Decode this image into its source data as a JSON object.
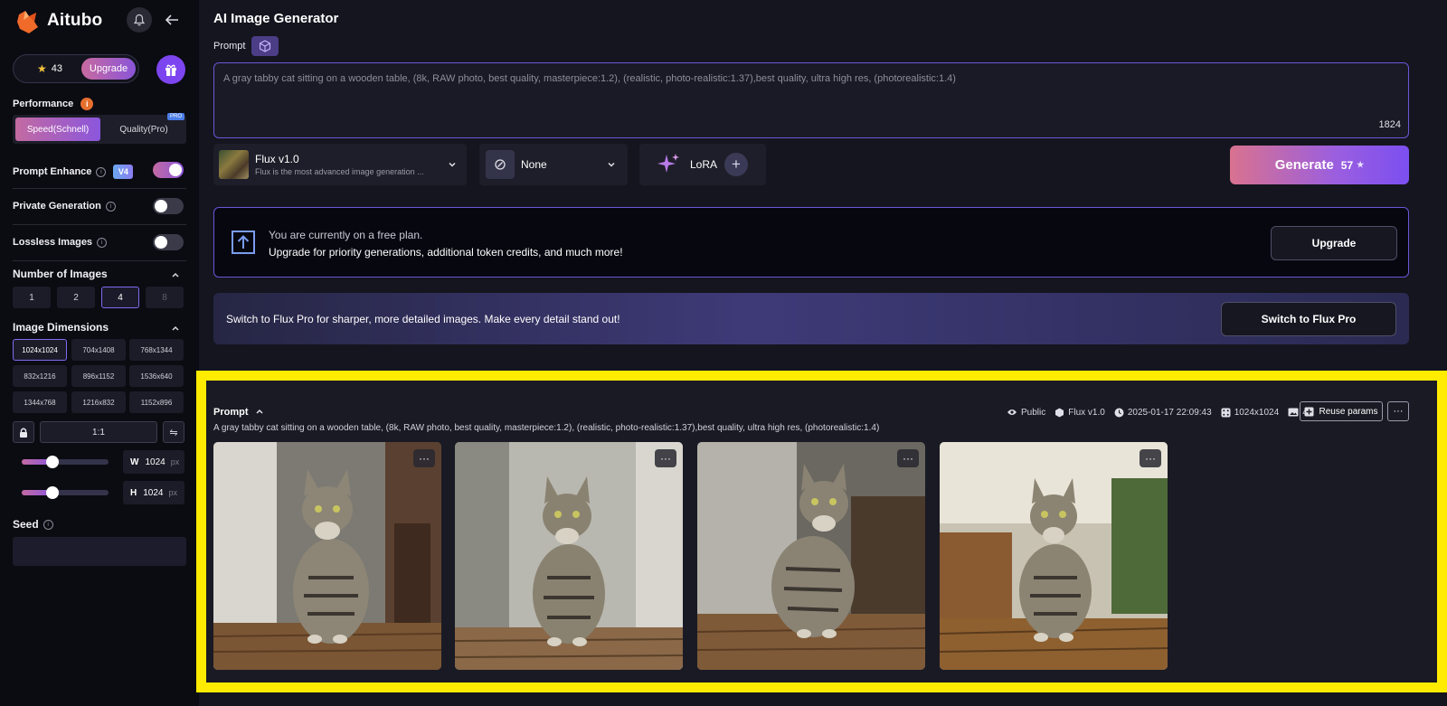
{
  "brand": {
    "name": "Aitubo"
  },
  "account": {
    "credits": "43",
    "upgrade_label": "Upgrade"
  },
  "sidebar": {
    "performance": {
      "label": "Performance",
      "info": "i",
      "options": [
        "Speed(Schnell)",
        "Quality(Pro)"
      ],
      "selected": "Speed(Schnell)",
      "pro_tag": "PRO"
    },
    "prompt_enhance": {
      "label": "Prompt Enhance",
      "badge": "V4",
      "enabled": true
    },
    "private_generation": {
      "label": "Private Generation",
      "enabled": false
    },
    "lossless_images": {
      "label": "Lossless Images",
      "enabled": false
    },
    "number_of_images": {
      "label": "Number of Images",
      "options": [
        "1",
        "2",
        "4",
        "8"
      ],
      "selected": "4",
      "disabled": [
        "8"
      ]
    },
    "image_dimensions": {
      "label": "Image Dimensions",
      "options": [
        "1024x1024",
        "704x1408",
        "768x1344",
        "832x1216",
        "896x1152",
        "1536x640",
        "1344x768",
        "1216x832",
        "1152x896"
      ],
      "selected": "1024x1024",
      "ratio": "1:1",
      "width": {
        "label": "W",
        "value": "1024",
        "unit": "px"
      },
      "height": {
        "label": "H",
        "value": "1024",
        "unit": "px"
      }
    },
    "seed": {
      "label": "Seed",
      "value": ""
    }
  },
  "main": {
    "title": "AI Image Generator",
    "prompt_label": "Prompt",
    "prompt_text": "A gray tabby cat sitting on a wooden table, (8k, RAW photo, best quality, masterpiece:1.2), (realistic, photo-realistic:1.37),best quality, ultra high res, (photorealistic:1.4)",
    "char_count": "1824",
    "model": {
      "name": "Flux v1.0",
      "description": "Flux is the most advanced image generation ..."
    },
    "style": {
      "name": "None"
    },
    "lora": {
      "label": "LoRA"
    },
    "generate": {
      "label": "Generate",
      "cost": "57"
    },
    "plan_banner": {
      "line1": "You are currently on a free plan.",
      "line2": "Upgrade for priority generations, additional token credits, and much more!",
      "button": "Upgrade"
    },
    "pro_banner": {
      "text": "Switch to Flux Pro for sharper, more detailed images. Make every detail stand out!",
      "button": "Switch to Flux Pro"
    }
  },
  "result": {
    "prompt_label": "Prompt",
    "prompt_text": "A gray tabby cat sitting on a wooden table, (8k, RAW photo, best quality, masterpiece:1.2), (realistic, photo-realistic:1.37),best quality, ultra high res, (photorealistic:1.4)",
    "visibility": "Public",
    "model": "Flux v1.0",
    "timestamp": "2025-01-17 22:09:43",
    "size": "1024x1024",
    "count": "4",
    "reuse_label": "Reuse params",
    "images": [
      "cat-image-1",
      "cat-image-2",
      "cat-image-3",
      "cat-image-4"
    ]
  },
  "colors": {
    "accent": "#7d45f0",
    "highlight_frame": "#ffeb00",
    "generate_start": "#d9728f",
    "generate_end": "#7c4ff0"
  }
}
